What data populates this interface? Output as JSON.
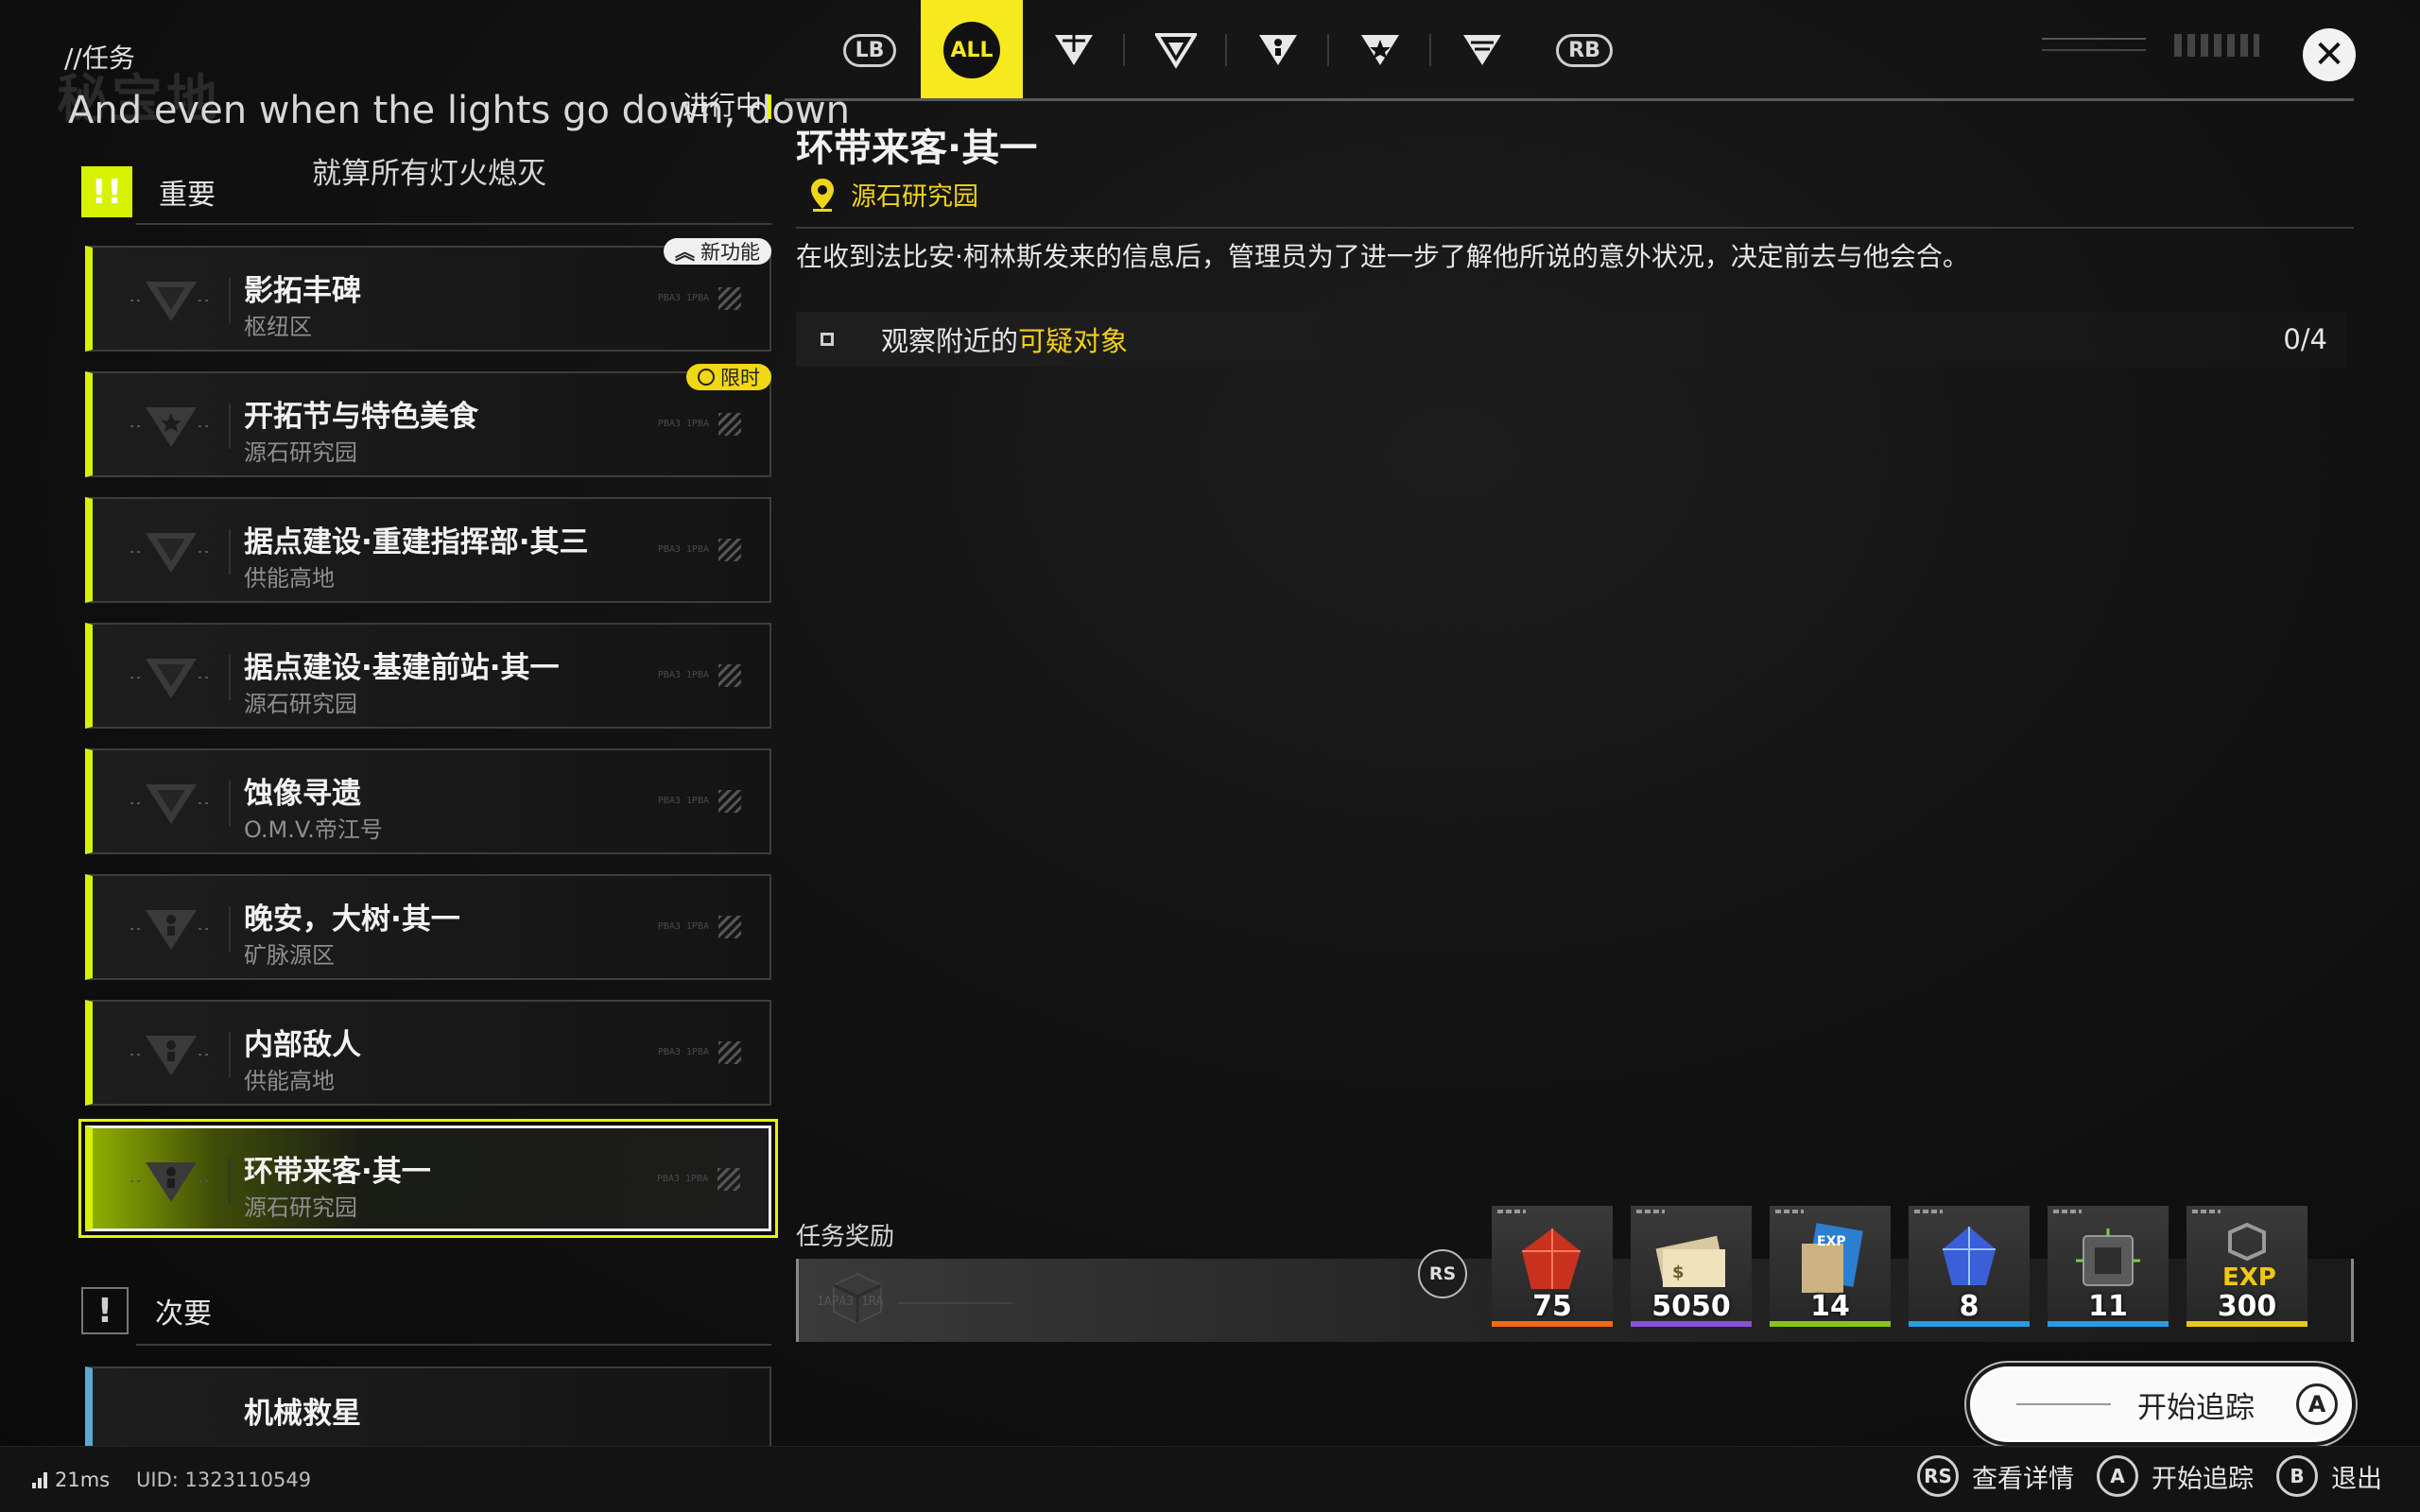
{
  "header": {
    "breadcrumb": "//任务",
    "watermark": "秘宝地",
    "subtitle_en": "And even when the lights go down, down",
    "subtitle_zh": "就算所有灯火熄灭",
    "status_tag": "进行中"
  },
  "tabs": [
    {
      "label": "LB",
      "kind": "bumper"
    },
    {
      "label": "ALL",
      "kind": "all",
      "active": true
    },
    {
      "label": "ENDFIELD",
      "kind": "icon"
    },
    {
      "label": "",
      "kind": "icon"
    },
    {
      "label": "",
      "kind": "icon"
    },
    {
      "label": "",
      "kind": "icon"
    },
    {
      "label": "",
      "kind": "icon"
    },
    {
      "label": "RB",
      "kind": "bumper"
    }
  ],
  "sections": {
    "major": {
      "icon": "!!",
      "label": "重要"
    },
    "minor": {
      "icon": "!",
      "label": "次要"
    }
  },
  "quests": [
    {
      "title": "影拓丰碑",
      "location": "枢纽区",
      "badge": "新功能",
      "badge_type": "new",
      "code": "PBA3 1PBA"
    },
    {
      "title": "开拓节与特色美食",
      "location": "源石研究园",
      "badge": "限时",
      "badge_type": "limited",
      "code": "PBA3 1PBA"
    },
    {
      "title": "据点建设·重建指挥部·其三",
      "location": "供能高地",
      "badge": "",
      "code": "PBA3 1PBA"
    },
    {
      "title": "据点建设·基建前站·其一",
      "location": "源石研究园",
      "badge": "",
      "code": "PBA3 1PBA"
    },
    {
      "title": "蚀像寻遗",
      "location": "O.M.V.帝江号",
      "badge": "",
      "code": "PBA3 1PBA"
    },
    {
      "title": "晚安，大树·其一",
      "location": "矿脉源区",
      "badge": "",
      "code": "PBA3 1PBA"
    },
    {
      "title": "内部敌人",
      "location": "供能高地",
      "badge": "",
      "code": "PBA3 1PBA"
    },
    {
      "title": "环带来客·其一",
      "location": "源石研究园",
      "badge": "",
      "code": "PBA3 1PBA",
      "selected": true
    }
  ],
  "minor_quests": [
    {
      "title": "机械救星",
      "location": ""
    }
  ],
  "detail": {
    "title": "环带来客·其一",
    "location": "源石研究园",
    "description": "在收到法比安·柯林斯发来的信息后，管理员为了进一步了解他所说的意外状况，决定前去与他会合。",
    "objective_prefix": "观察附近的",
    "objective_highlight": "可疑对象",
    "objective_progress": "0/4"
  },
  "rewards": {
    "label": "任务奖励",
    "ghost_text": "1APA3 1RA",
    "rs_label": "RS",
    "items": [
      {
        "name": "red-crystal",
        "qty": "75",
        "stripe": "#f06a18"
      },
      {
        "name": "currency-notes",
        "qty": "5050",
        "stripe": "#8a4fd8"
      },
      {
        "name": "exp-card",
        "qty": "14",
        "stripe": "#8bc21c"
      },
      {
        "name": "blue-crystal",
        "qty": "8",
        "stripe": "#2a9be0"
      },
      {
        "name": "chip-module",
        "qty": "11",
        "stripe": "#2a9be0"
      },
      {
        "name": "exp-token",
        "qty": "300",
        "stripe": "#e8c81a",
        "tag": "EXP"
      }
    ]
  },
  "track_button": {
    "label": "开始追踪",
    "key": "A"
  },
  "footer": {
    "ping": "21ms",
    "uid": "UID: 1323110549",
    "hints": [
      {
        "key": "RS",
        "label": "查看详情"
      },
      {
        "key": "A",
        "label": "开始追踪"
      },
      {
        "key": "B",
        "label": "退出"
      }
    ]
  },
  "colors": {
    "accent": "#d7f200",
    "tab_active": "#f6ea1f",
    "highlight": "#f3cf17",
    "panel": "#161616"
  }
}
